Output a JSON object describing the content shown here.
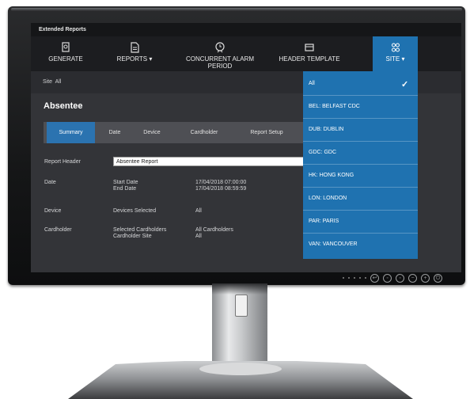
{
  "app": {
    "title": "Extended Reports"
  },
  "toolbar": {
    "generate": "GENERATE",
    "reports": "REPORTS ▾",
    "concurrent_line1": "CONCURRENT ALARM",
    "concurrent_line2": "PERIOD",
    "header_template": "HEADER TEMPLATE",
    "site": "SITE ▾"
  },
  "site_bar": {
    "label": "Site",
    "value": "All"
  },
  "page": {
    "title": "Absentee"
  },
  "tabs": [
    "Summary",
    "Date",
    "Device",
    "Cardholder",
    "Report Setup"
  ],
  "form": {
    "report_header_label": "Report Header",
    "report_header_value": "Absentee Report",
    "date_label": "Date",
    "start_label": "Start Date",
    "end_label": "End Date",
    "start_value": "17/04/2018 07:00:00",
    "end_value": "17/04/2018 08:59:59",
    "device_label": "Device",
    "devices_selected_label": "Devices Selected",
    "devices_selected_value": "All",
    "cardholder_label": "Cardholder",
    "selected_cardholders_label": "Selected Cardholders",
    "cardholder_site_label": "Cardholder Site",
    "selected_cardholders_value": "All Cardholders",
    "cardholder_site_value": "All"
  },
  "site_dropdown": {
    "options": [
      "All",
      "BEL: BELFAST CDC",
      "DUB: DUBLIN",
      "GDC: GDC",
      "HK: HONG KONG",
      "LON: LONDON",
      "PAR: PARIS",
      "VAN: VANCOUVER"
    ],
    "checkmark": "✓"
  },
  "colors": {
    "accent": "#1f72b0",
    "screen_bg": "#333438",
    "toolbar_bg": "#1c1d20"
  }
}
